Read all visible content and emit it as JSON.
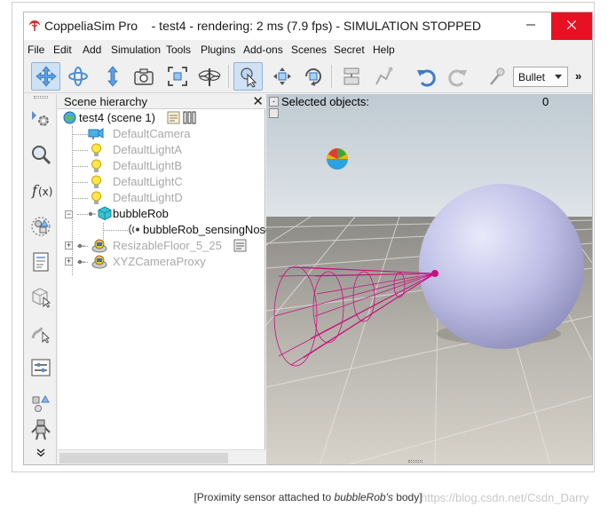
{
  "window": {
    "app_name": "CoppeliaSim Pro",
    "title_rest": "- test4 - rendering: 2 ms (7.9 fps) - SIMULATION STOPPED"
  },
  "menu": [
    "File",
    "Edit",
    "Add",
    "Simulation",
    "Tools",
    "Plugins",
    "Add-ons",
    "Scenes",
    "Secret",
    "Help"
  ],
  "toolbar": {
    "physics_engine": "Bullet",
    "overflow": "»"
  },
  "hierarchy": {
    "title": "Scene hierarchy",
    "close": "✕",
    "scene": "test4 (scene 1)",
    "items": [
      {
        "label": "DefaultCamera",
        "icon": "camera-icon",
        "enabled": false
      },
      {
        "label": "DefaultLightA",
        "icon": "light-icon",
        "enabled": false
      },
      {
        "label": "DefaultLightB",
        "icon": "light-icon",
        "enabled": false
      },
      {
        "label": "DefaultLightC",
        "icon": "light-icon",
        "enabled": false
      },
      {
        "label": "DefaultLightD",
        "icon": "light-icon",
        "enabled": false
      },
      {
        "label": "bubbleRob",
        "icon": "shape-icon",
        "enabled": true
      },
      {
        "label": "bubbleRob_sensingNose",
        "icon": "proximity-sensor-icon",
        "enabled": true
      },
      {
        "label": "ResizableFloor_5_25",
        "icon": "model-icon",
        "enabled": false
      },
      {
        "label": "XYZCameraProxy",
        "icon": "model-icon",
        "enabled": false
      }
    ]
  },
  "viewport": {
    "selected_label": "Selected objects:",
    "selected_count": "0"
  },
  "caption": {
    "prefix": "[Proximity sensor attached to ",
    "italic": "bubbleRob's",
    "suffix": " body]"
  },
  "watermark": "https://blog.csdn.net/Csdn_Darry"
}
